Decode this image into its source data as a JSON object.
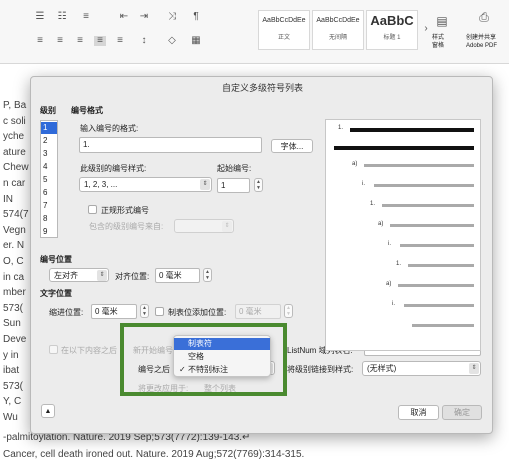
{
  "ribbon": {
    "styles": [
      {
        "sample": "AaBbCcDdEe",
        "label": "正文"
      },
      {
        "sample": "AaBbCcDdEe",
        "label": "无间隔"
      },
      {
        "sample": "AaBbC",
        "label": "标题 1"
      }
    ],
    "styles_pane_label": "样式\n窗格",
    "adobe_label": "创建并共享\nAdobe PDF"
  },
  "doc": {
    "lines": [
      "P, Ba",
      "c soli",
      "yche",
      "ature",
      "Chew",
      "n car",
      "IN",
      "574(7",
      "Vegn",
      "er. N",
      "O, C",
      "in ca",
      "mber",
      "573(",
      "Sun",
      "Deve",
      "y in",
      "ibat",
      "573(",
      "Y, C",
      "Wu"
    ],
    "bottom_lines": [
      "-palmitoylation. Nature. 2019 Sep;573(7772):139-143.↵",
      "Cancer, cell death ironed out. Nature. 2019 Aug;572(7769):314-315."
    ]
  },
  "dialog": {
    "title": "自定义多级符号列表",
    "level_label": "级别",
    "levels": [
      "1",
      "2",
      "3",
      "4",
      "5",
      "6",
      "7",
      "8",
      "9"
    ],
    "number_format_label": "编号格式",
    "enter_format_label": "输入编号的格式:",
    "format_value": "1.",
    "font_button": "字体...",
    "number_style_label": "此级别的编号样式:",
    "number_style_value": "1, 2, 3, ...",
    "start_at_label": "起始编号:",
    "start_at_value": "1",
    "legal_style_label": "正规形式编号",
    "include_level_label": "包含的级别编号来自:",
    "number_position_label": "编号位置",
    "alignment_value": "左对齐",
    "aligned_at_label": "对齐位置:",
    "aligned_at_value": "0 毫米",
    "text_position_label": "文字位置",
    "indent_at_label": "缩进位置:",
    "indent_at_value": "0 毫米",
    "tab_stop_label": "制表位添加位置:",
    "tab_stop_value": "0 毫米",
    "restart_label": "在以下内容之后",
    "restart_label_tail": "新开始编号:",
    "follow_number_label": "编号之后",
    "listnum_label": "ListNum 域列表名:",
    "link_style_label": "将级别链接到样式:",
    "link_style_value": "(无样式)",
    "apply_to_label": "将更改应用于:",
    "apply_to_value": "整个列表",
    "cancel_button": "取消",
    "ok_button": "确定",
    "collapse_icon": "chevron-up-icon"
  },
  "popup_menu": {
    "items": [
      "制表符",
      "空格",
      "不特别标注"
    ],
    "highlighted_index": 0,
    "checked_index": 2,
    "check_glyph": "✓"
  },
  "preview": {
    "numbers": [
      "1.",
      "a)",
      "i.",
      "1.",
      "a)",
      "i.",
      "1.",
      "a)",
      "i."
    ]
  },
  "colors": {
    "highlight_box": "#4a8a30",
    "selection": "#2f6ad9"
  }
}
